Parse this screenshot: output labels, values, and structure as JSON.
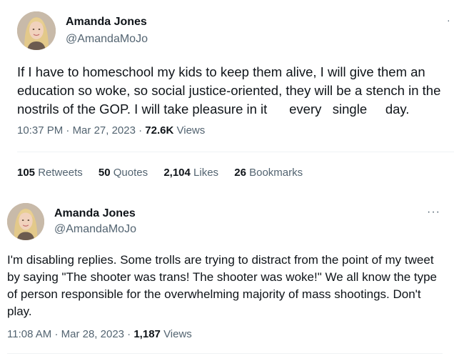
{
  "tweet1": {
    "name": "Amanda Jones",
    "handle": "@AmandaMoJo",
    "text": "If I have to homeschool my kids to keep them alive, I will give them an education so woke, so social justice-oriented, they will be a stench in the nostrils of the GOP. I will take pleasure in it      every   single     day.",
    "time": "10:37 PM",
    "date": "Mar 27, 2023",
    "views_count": "72.6K",
    "views_label": "Views",
    "more_label": "·",
    "stats": {
      "retweets_count": "105",
      "retweets_label": "Retweets",
      "quotes_count": "50",
      "quotes_label": "Quotes",
      "likes_count": "2,104",
      "likes_label": "Likes",
      "bookmarks_count": "26",
      "bookmarks_label": "Bookmarks"
    }
  },
  "tweet2": {
    "name": "Amanda Jones",
    "handle": "@AmandaMoJo",
    "text": "I'm disabling replies. Some trolls are trying to distract from the point of my tweet by saying \"The shooter was trans! The shooter was woke!\" We all know the type of person responsible for the overwhelming majority of mass shootings. Don't play.",
    "time": "11:08 AM",
    "date": "Mar 28, 2023",
    "views_count": "1,187",
    "views_label": "Views",
    "more_label": "···"
  },
  "separator": "·",
  "colors": {
    "text_primary": "#0f1419",
    "text_secondary": "#536471",
    "divider": "#eff3f4",
    "background": "#ffffff"
  }
}
